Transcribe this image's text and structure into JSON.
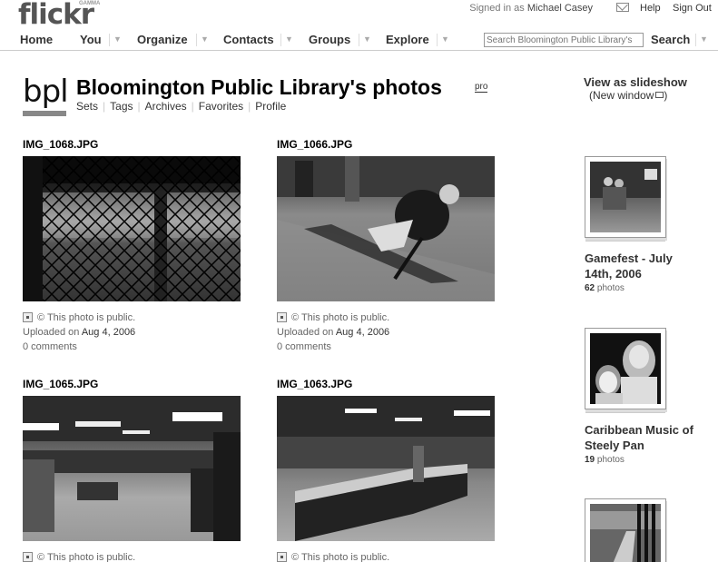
{
  "header": {
    "logo": "flickr",
    "logo_tag": "GAMMA",
    "signed_in_prefix": "Signed in as",
    "user": "Michael Casey",
    "help": "Help",
    "sign_out": "Sign Out"
  },
  "nav": {
    "items": [
      "Home",
      "You",
      "Organize",
      "Contacts",
      "Groups",
      "Explore"
    ],
    "search_placeholder": "Search Bloomington Public Library's",
    "search_button": "Search"
  },
  "profile": {
    "buddy_text": "bpl",
    "title": "Bloomington Public Library's photos",
    "badge": "pro",
    "subnav": [
      "Sets",
      "Tags",
      "Archives",
      "Favorites",
      "Profile"
    ],
    "slideshow": "View as slideshow",
    "new_window": "(New window"
  },
  "photos": [
    {
      "title": "IMG_1068.JPG",
      "privacy": "© This photo is public.",
      "uploaded_prefix": "Uploaded on",
      "date": "Aug 4, 2006",
      "comments": "0 comments"
    },
    {
      "title": "IMG_1066.JPG",
      "privacy": "© This photo is public.",
      "uploaded_prefix": "Uploaded on",
      "date": "Aug 4, 2006",
      "comments": "0 comments"
    },
    {
      "title": "IMG_1065.JPG",
      "privacy": "© This photo is public."
    },
    {
      "title": "IMG_1063.JPG",
      "privacy": "© This photo is public."
    }
  ],
  "sets": [
    {
      "title": "Gamefest - July 14th, 2006",
      "count": "62",
      "count_label": "photos"
    },
    {
      "title": "Caribbean Music of Steely Pan",
      "count": "19",
      "count_label": "photos"
    },
    {
      "title": "",
      "count": "",
      "count_label": ""
    }
  ]
}
